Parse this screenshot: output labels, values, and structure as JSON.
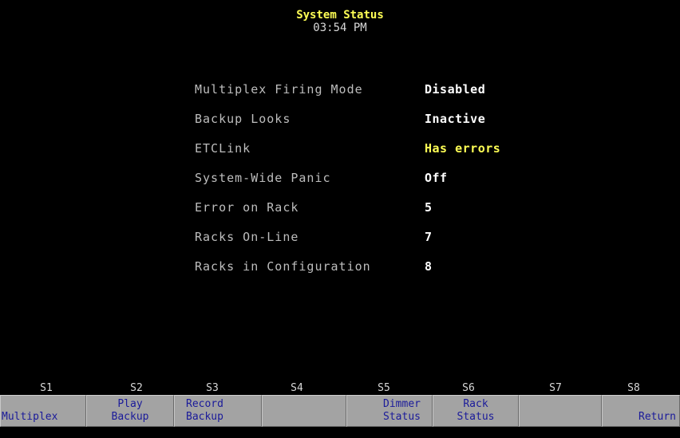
{
  "header": {
    "title": "System Status",
    "time": "03:54 PM"
  },
  "status_rows": [
    {
      "label": "Multiplex Firing Mode",
      "value": "Disabled",
      "value_color": "#ffffff"
    },
    {
      "label": "Backup Looks",
      "value": "Inactive",
      "value_color": "#ffffff"
    },
    {
      "label": "ETCLink",
      "value": "Has errors",
      "value_color": "#ffff55"
    },
    {
      "label": "System-Wide Panic",
      "value": "Off",
      "value_color": "#ffffff"
    },
    {
      "label": "Error on Rack",
      "value": "5",
      "value_color": "#ffffff"
    },
    {
      "label": "Racks On-Line",
      "value": "7",
      "value_color": "#ffffff"
    },
    {
      "label": "Racks in Configuration",
      "value": "8",
      "value_color": "#ffffff"
    }
  ],
  "softkeys": [
    {
      "id": "S1",
      "line1": "",
      "line2": "Multiplex"
    },
    {
      "id": "S2",
      "line1": "Play",
      "line2": "Backup"
    },
    {
      "id": "S3",
      "line1": "Record",
      "line2": "Backup"
    },
    {
      "id": "S4",
      "line1": "",
      "line2": ""
    },
    {
      "id": "S5",
      "line1": "Dimmer",
      "line2": "Status"
    },
    {
      "id": "S6",
      "line1": "Rack",
      "line2": "Status"
    },
    {
      "id": "S7",
      "line1": "",
      "line2": ""
    },
    {
      "id": "S8",
      "line1": "",
      "line2": "Return"
    }
  ],
  "colors": {
    "background": "#000000",
    "title": "#ffff55",
    "label": "#bdbdbd",
    "value": "#ffffff",
    "warning": "#ffff55",
    "softkey_bg": "#a3a3a3",
    "softkey_text": "#1a1a9a"
  }
}
